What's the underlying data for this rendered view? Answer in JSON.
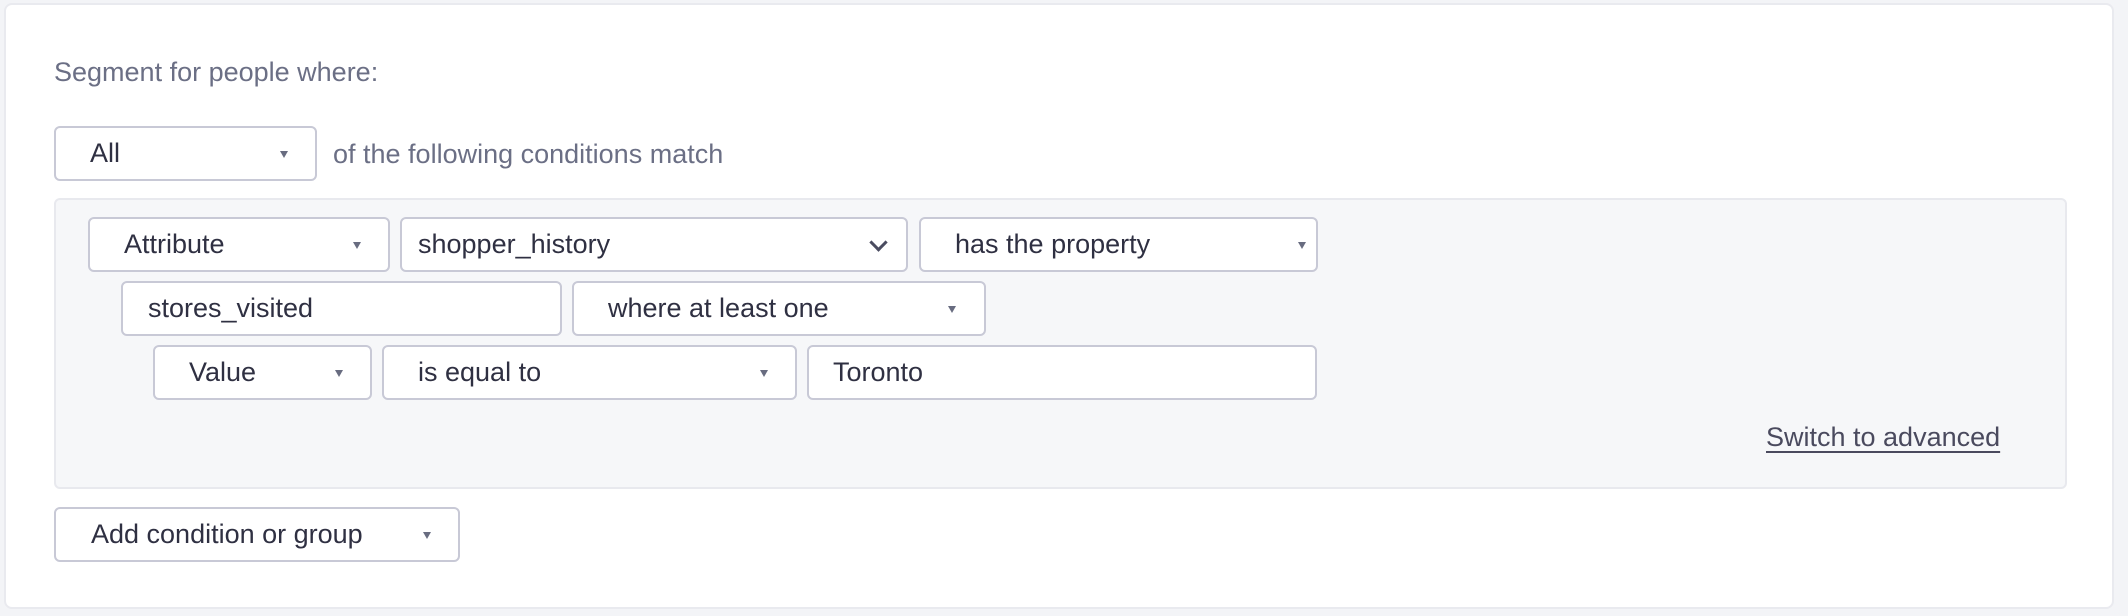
{
  "header": {
    "segment_label": "Segment for people where:"
  },
  "match": {
    "selected": "All",
    "suffix": "of the following conditions match"
  },
  "condition": {
    "row1": {
      "type_select": "Attribute",
      "attribute_select": "shopper_history",
      "operator_select": "has the property"
    },
    "row2": {
      "property_input": "stores_visited",
      "quantifier_select": "where at least one"
    },
    "row3": {
      "field_select": "Value",
      "comparison_select": "is equal to",
      "value_input": "Toronto"
    },
    "switch_link": "Switch to advanced"
  },
  "footer": {
    "add_button": "Add condition or group"
  },
  "icons": {
    "select_caret": "caret-down-icon",
    "combobox_chevron": "chevron-down-icon"
  },
  "colors": {
    "label": "#6b6f85",
    "text": "#2f3042",
    "border": "#c8c9d6",
    "panel_bg": "#f6f7f9",
    "link": "#4a4a5e"
  }
}
